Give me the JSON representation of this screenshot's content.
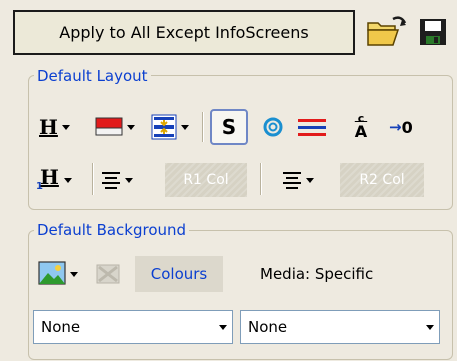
{
  "toolbar": {
    "apply_label": "Apply to All Except InfoScreens",
    "open_icon": "folder-open-icon",
    "save_icon": "floppy-disk-icon"
  },
  "layout": {
    "legend": "Default Layout",
    "row1": {
      "heading_glyph": "H",
      "s_glyph": "S",
      "o_glyph": "o",
      "c_glyph": "c",
      "a_glyph": "A",
      "zero_glyph": "0"
    },
    "row2": {
      "heading_glyph": "H",
      "sub_glyph": "1",
      "r1_label": "R1 Col",
      "r2_label": "R2 Col"
    }
  },
  "background": {
    "legend": "Default Background",
    "colours_label": "Colours",
    "media_label": "Media: Specific",
    "select1_value": "None",
    "select2_value": "None"
  },
  "colors": {
    "legend_blue": "#0b3fd0",
    "panel_bg": "#eeeae0"
  }
}
